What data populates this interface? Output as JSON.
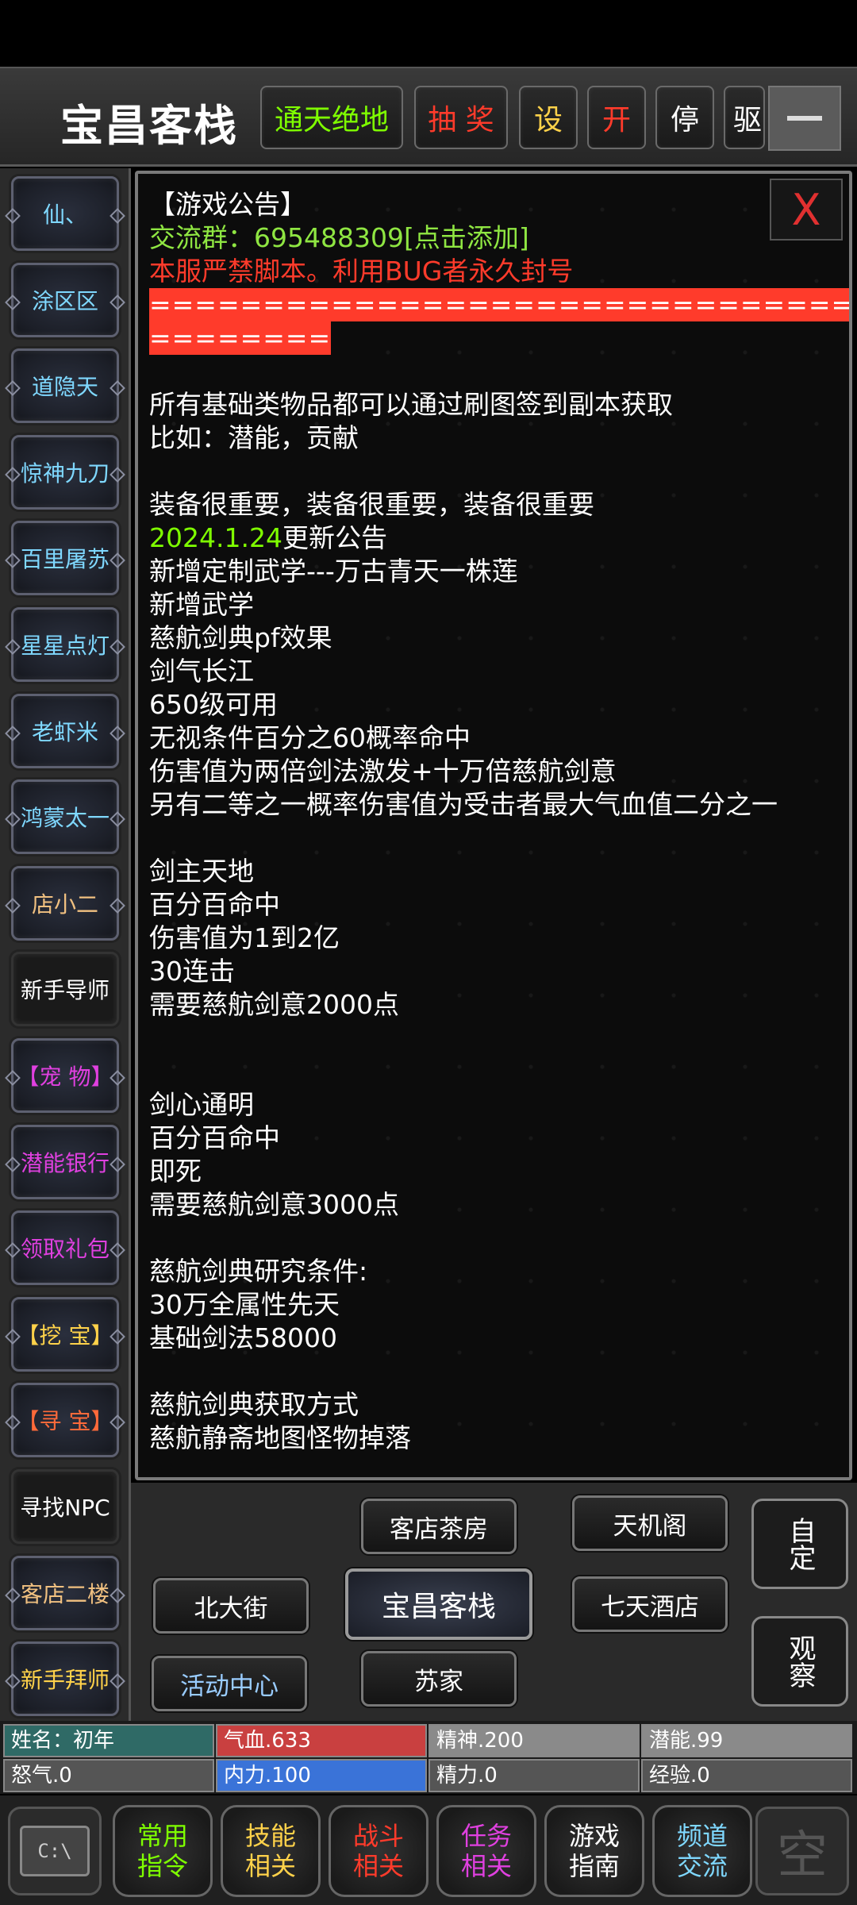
{
  "header": {
    "title": "宝昌客栈",
    "buttons": [
      {
        "label": "通天绝地",
        "color": "#7fff00"
      },
      {
        "label": "抽 奖",
        "color": "#ff3b2b"
      },
      {
        "label": "设",
        "color": "#ffd24a"
      },
      {
        "label": "开",
        "color": "#ff3b2b"
      },
      {
        "label": "停",
        "color": "#ffffff"
      },
      {
        "label": "驱",
        "color": "#ffffff"
      }
    ]
  },
  "sidebar": {
    "items": [
      {
        "label": "仙、",
        "color": "#7fd8ff"
      },
      {
        "label": "涂区区",
        "color": "#7fd8ff"
      },
      {
        "label": "道隐天",
        "color": "#7fd8ff"
      },
      {
        "label": "惊神九刀",
        "color": "#7fd8ff"
      },
      {
        "label": "百里屠苏",
        "color": "#7fd8ff"
      },
      {
        "label": "星星点灯",
        "color": "#7fd8ff"
      },
      {
        "label": "老虾米",
        "color": "#7fd8ff"
      },
      {
        "label": "鸿蒙太一",
        "color": "#7fd8ff"
      },
      {
        "label": "店小二",
        "color": "#f0c080"
      },
      {
        "label": "新手导师",
        "color": "#ffffff"
      },
      {
        "label": "【宠 物】",
        "color": "#e040e0"
      },
      {
        "label": "潜能银行",
        "color": "#e040e0"
      },
      {
        "label": "领取礼包",
        "color": "#e040e0"
      },
      {
        "label": "【挖 宝】",
        "color": "#ffd24a"
      },
      {
        "label": "【寻 宝】",
        "color": "#ff6a3a"
      },
      {
        "label": "寻找NPC",
        "color": "#ffffff"
      },
      {
        "label": "客店二楼",
        "color": "#f0c080"
      },
      {
        "label": "新手拜师",
        "color": "#ffd24a"
      }
    ]
  },
  "notice": {
    "close_label": "X",
    "lines": [
      {
        "text": "【游戏公告】",
        "style": "normal"
      },
      {
        "text": "交流群：695488309[点击添加]",
        "style": "link"
      },
      {
        "text": "本服严禁脚本。利用BUG者永久封号",
        "style": "red"
      },
      {
        "text": "=============================================",
        "style": "redbar"
      },
      {
        "text": "========",
        "style": "redbar"
      },
      {
        "text": "",
        "style": "normal"
      },
      {
        "text": "所有基础类物品都可以通过刷图签到副本获取",
        "style": "normal"
      },
      {
        "text": "比如：潜能，贡献",
        "style": "normal"
      },
      {
        "text": "",
        "style": "normal"
      },
      {
        "text": "装备很重要，装备很重要，装备很重要",
        "style": "normal"
      },
      {
        "text": "2024.1.24",
        "suffix": "更新公告",
        "style": "date"
      },
      {
        "text": "新增定制武学---万古青天一株莲",
        "style": "normal"
      },
      {
        "text": "新增武学",
        "style": "normal"
      },
      {
        "text": "慈航剑典pf效果",
        "style": "normal"
      },
      {
        "text": "剑气长江",
        "style": "normal"
      },
      {
        "text": "650级可用",
        "style": "normal"
      },
      {
        "text": "无视条件百分之60概率命中",
        "style": "normal"
      },
      {
        "text": "伤害值为两倍剑法激发+十万倍慈航剑意",
        "style": "normal"
      },
      {
        "text": "另有二等之一概率伤害值为受击者最大气血值二分之一",
        "style": "normal"
      },
      {
        "text": "",
        "style": "normal"
      },
      {
        "text": "剑主天地",
        "style": "normal"
      },
      {
        "text": "百分百命中",
        "style": "normal"
      },
      {
        "text": "伤害值为1到2亿",
        "style": "normal"
      },
      {
        "text": "30连击",
        "style": "normal"
      },
      {
        "text": "需要慈航剑意2000点",
        "style": "normal"
      },
      {
        "text": "",
        "style": "normal"
      },
      {
        "text": "",
        "style": "normal"
      },
      {
        "text": "剑心通明",
        "style": "normal"
      },
      {
        "text": "百分百命中",
        "style": "normal"
      },
      {
        "text": "即死",
        "style": "normal"
      },
      {
        "text": "需要慈航剑意3000点",
        "style": "normal"
      },
      {
        "text": "",
        "style": "normal"
      },
      {
        "text": "慈航剑典研究条件:",
        "style": "normal"
      },
      {
        "text": "30万全属性先天",
        "style": "normal"
      },
      {
        "text": "基础剑法58000",
        "style": "normal"
      },
      {
        "text": "",
        "style": "normal"
      },
      {
        "text": "慈航剑典获取方式",
        "style": "normal"
      },
      {
        "text": "慈航静斋地图怪物掉落",
        "style": "normal"
      }
    ]
  },
  "map": {
    "north": "客店茶房",
    "northeast": "天机阁",
    "west": "北大街",
    "current": "宝昌客栈",
    "east": "七天酒店",
    "southwest": "活动中心",
    "south": "苏家",
    "action_custom": "自定",
    "action_observe": "观察"
  },
  "stats": {
    "name": "姓名：初年",
    "hp": "气血.633",
    "spirit": "精神.200",
    "potential": "潜能.99",
    "rage": "怒气.0",
    "internal": "内力.100",
    "energy": "精力.0",
    "exp": "经验.0",
    "colors": {
      "name": "#2f6a66",
      "hp": "#c94040",
      "spirit": "#8a8a8a",
      "potential": "#8a8a8a",
      "rage": "#555555",
      "internal": "#3a73d8",
      "energy": "#555555",
      "exp": "#555555"
    }
  },
  "bottomnav": {
    "console_label": "C:\\",
    "items": [
      {
        "label": "常用指令",
        "color": "#7fff00"
      },
      {
        "label": "技能相关",
        "color": "#ffd24a"
      },
      {
        "label": "战斗相关",
        "color": "#ff3b2b"
      },
      {
        "label": "任务相关",
        "color": "#e040e0"
      },
      {
        "label": "游戏指南",
        "color": "#ffffff"
      },
      {
        "label": "频道交流",
        "color": "#7fd8ff"
      }
    ],
    "seal_glyph": "空"
  }
}
